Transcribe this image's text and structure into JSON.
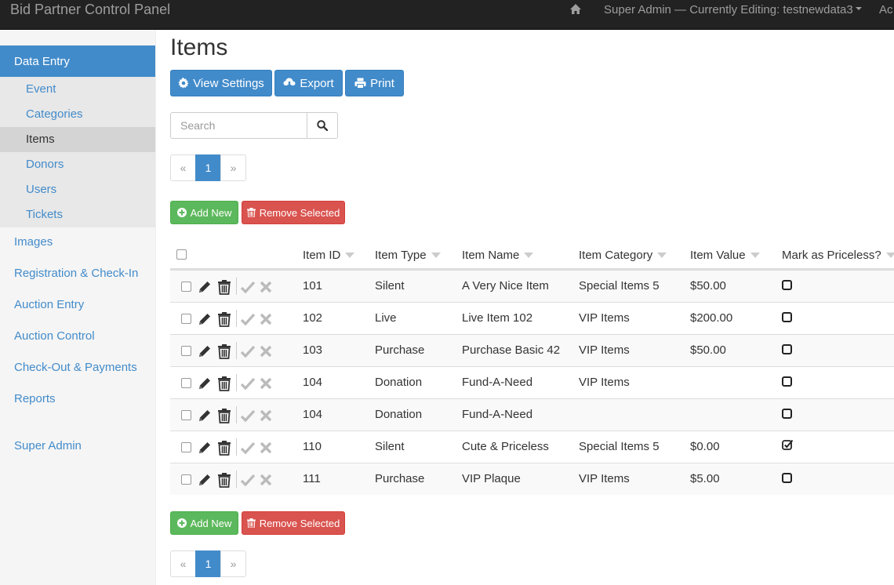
{
  "navbar": {
    "brand": "Bid Partner Control Panel",
    "user_menu": "Super Admin — Currently Editing: testnewdata3",
    "account_menu": "Ac"
  },
  "sidebar": {
    "active_section": "Data Entry",
    "sub_items": [
      {
        "label": "Event"
      },
      {
        "label": "Categories"
      },
      {
        "label": "Items"
      },
      {
        "label": "Donors"
      },
      {
        "label": "Users"
      },
      {
        "label": "Tickets"
      }
    ],
    "items": [
      {
        "label": "Images"
      },
      {
        "label": "Registration & Check-In"
      },
      {
        "label": "Auction Entry"
      },
      {
        "label": "Auction Control"
      },
      {
        "label": "Check-Out & Payments"
      },
      {
        "label": "Reports"
      },
      {
        "label": "Super Admin"
      }
    ]
  },
  "main": {
    "title": "Items",
    "view_settings_label": "View Settings",
    "export_label": "Export",
    "print_label": "Print",
    "search_placeholder": "Search",
    "pager": {
      "prev": "«",
      "current": "1",
      "next": "»"
    },
    "add_new_label": "Add New",
    "remove_selected_label": "Remove Selected"
  },
  "table": {
    "columns": [
      "Item ID",
      "Item Type",
      "Item Name",
      "Item Category",
      "Item Value",
      "Mark as Priceless?"
    ],
    "rows": [
      {
        "id": "101",
        "type": "Silent",
        "name": "A Very Nice Item",
        "category": "Special Items 5",
        "value": "$50.00",
        "priceless": false
      },
      {
        "id": "102",
        "type": "Live",
        "name": "Live Item 102",
        "category": "VIP Items",
        "value": "$200.00",
        "priceless": false
      },
      {
        "id": "103",
        "type": "Purchase",
        "name": "Purchase Basic 42",
        "category": "VIP Items",
        "value": "$50.00",
        "priceless": false
      },
      {
        "id": "104",
        "type": "Donation",
        "name": "Fund-A-Need",
        "category": "VIP Items",
        "value": "",
        "priceless": false
      },
      {
        "id": "104",
        "type": "Donation",
        "name": "Fund-A-Need",
        "category": "",
        "value": "",
        "priceless": false
      },
      {
        "id": "110",
        "type": "Silent",
        "name": "Cute & Priceless",
        "category": "Special Items 5",
        "value": "$0.00",
        "priceless": true
      },
      {
        "id": "111",
        "type": "Purchase",
        "name": "VIP Plaque",
        "category": "VIP Items",
        "value": "$5.00",
        "priceless": false
      }
    ]
  },
  "colors": {
    "primary": "#428bca",
    "success": "#5cb85c",
    "danger": "#d9534f",
    "navbar": "#222222"
  },
  "icons": [
    "home-icon",
    "gear-icon",
    "cloud-download-icon",
    "print-icon",
    "search-icon",
    "plus-circle-icon",
    "trash-icon",
    "pencil-icon",
    "check-icon",
    "close-icon",
    "sort-caret-icon"
  ]
}
